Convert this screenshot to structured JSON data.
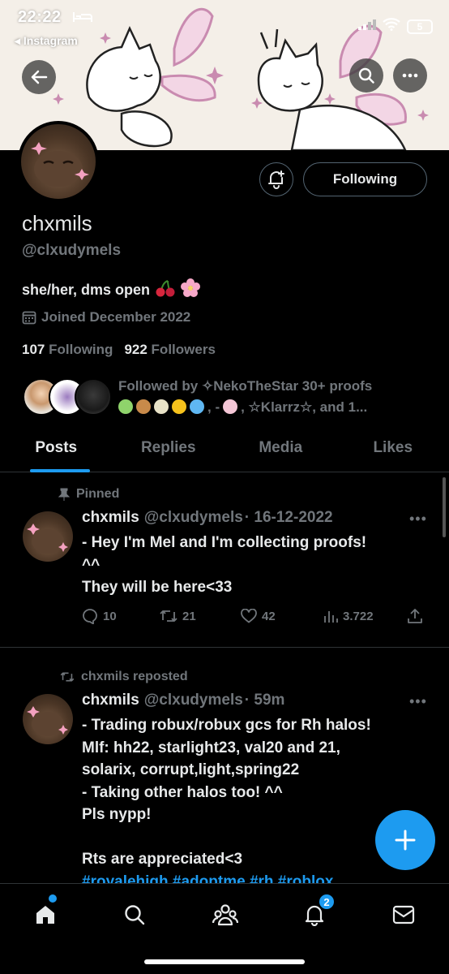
{
  "status_bar": {
    "time": "22:22",
    "back_app": "◂ Instagram",
    "battery": "5"
  },
  "profile": {
    "display_name": "chxmils",
    "handle": "@clxudymels",
    "bio": "she/her, dms open",
    "joined": "Joined December 2022",
    "following_count": "107",
    "following_label": "Following",
    "followers_count": "922",
    "followers_label": "Followers",
    "follow_button": "Following",
    "followed_by_line1": "Followed by ✧NekoTheStar 30+ proofs",
    "followed_by_line2_tail": ", ☆Klarrz☆, and 1..."
  },
  "tabs": [
    {
      "label": "Posts",
      "active": true
    },
    {
      "label": "Replies",
      "active": false
    },
    {
      "label": "Media",
      "active": false
    },
    {
      "label": "Likes",
      "active": false
    }
  ],
  "posts": [
    {
      "context": "Pinned",
      "name": "chxmils",
      "handle": "@clxudymels",
      "date": "· 16-12-2022",
      "text": "- Hey I'm Mel and I'm collecting proofs!\n^^\nThey will be here<33",
      "replies": "10",
      "reposts": "21",
      "likes": "42",
      "views": "3.722"
    },
    {
      "context": "chxmils reposted",
      "name": "chxmils",
      "handle": "@clxudymels",
      "date": "· 59m",
      "text": "- Trading robux/robux gcs for Rh halos!\nMlf: hh22, starlight23, val20 and 21,\nsolarix, corrupt,light,spring22\n- Taking other halos too! ^^\nPls nypp!\n\nRts are appreciated<3",
      "hashtags": "#royalehigh #adoptme #rh #roblox"
    }
  ],
  "nav": {
    "notifications_badge": "2"
  },
  "colors": {
    "accent": "#1d9bf0",
    "background": "#000000",
    "secondary_text": "#71767b"
  }
}
